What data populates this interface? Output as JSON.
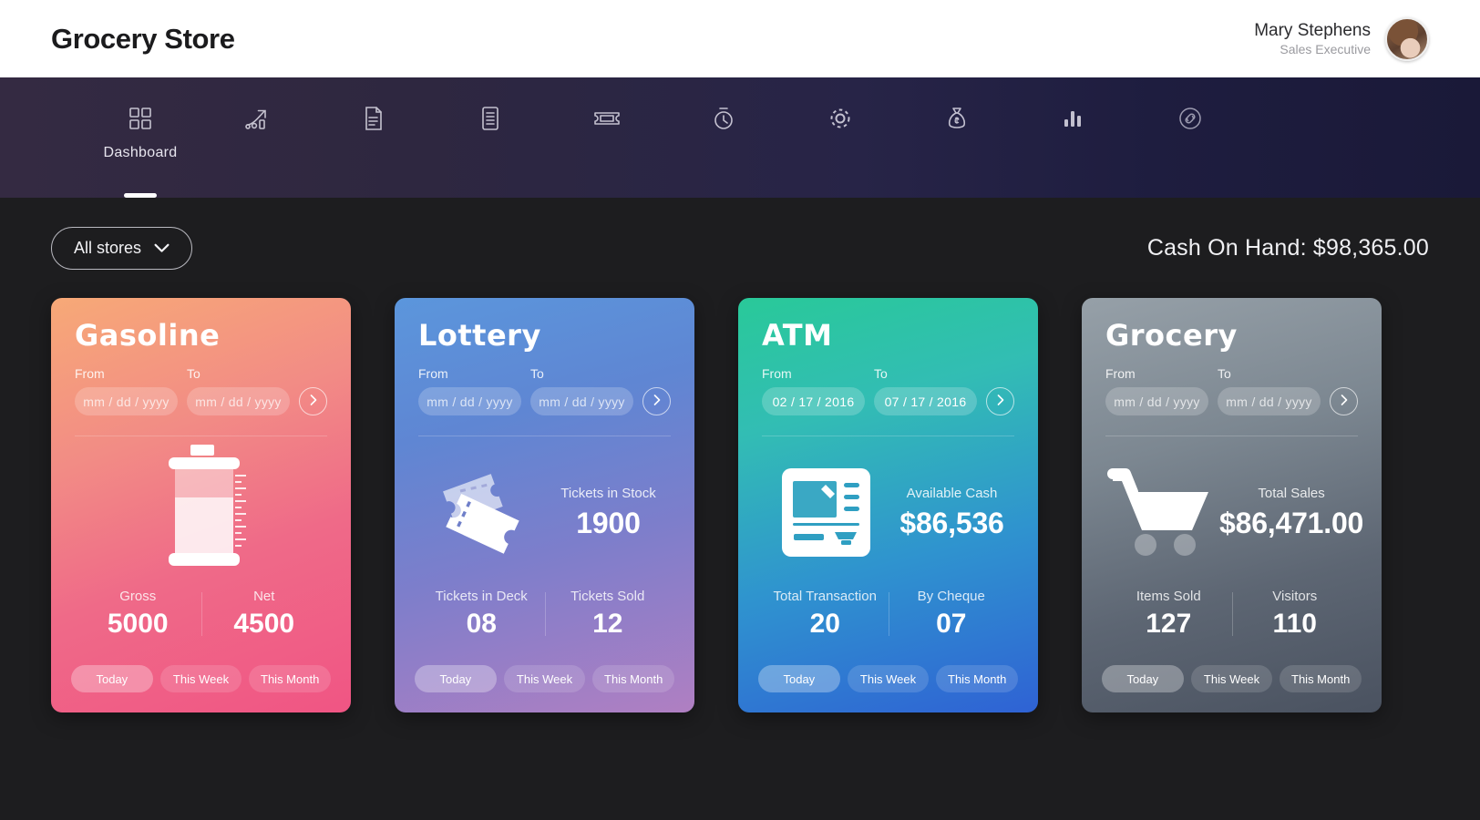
{
  "header": {
    "brand": "Grocery Store",
    "user": {
      "name": "Mary Stephens",
      "role": "Sales Executive",
      "avatar_icon": "user-avatar-photo"
    }
  },
  "nav": {
    "active_index": 0,
    "items": [
      {
        "label": "Dashboard",
        "icon": "grid-dashboard-icon"
      },
      {
        "label": "",
        "icon": "growth-chart-arrow-icon"
      },
      {
        "label": "",
        "icon": "document-report-icon"
      },
      {
        "label": "",
        "icon": "list-lines-icon"
      },
      {
        "label": "",
        "icon": "ticket-icon"
      },
      {
        "label": "",
        "icon": "stopwatch-icon"
      },
      {
        "label": "",
        "icon": "gear-settings-icon"
      },
      {
        "label": "",
        "icon": "money-bag-icon"
      },
      {
        "label": "",
        "icon": "bar-chart-icon"
      },
      {
        "label": "",
        "icon": "link-chain-icon"
      }
    ]
  },
  "toolbar": {
    "store_filter": "All stores",
    "store_filter_icon": "chevron-down-icon",
    "cash_on_hand": "Cash On Hand: $98,365.00"
  },
  "cards": [
    {
      "id": "gasoline",
      "title": "Gasoline",
      "visual_icon": "fuel-gauge-tank-icon",
      "from_label": "From",
      "to_label": "To",
      "from_value": "mm / dd / yyyy",
      "to_value": "mm / dd / yyyy",
      "from_is_placeholder": true,
      "to_is_placeholder": true,
      "go_icon": "chevron-right-icon",
      "headline_label": "",
      "headline_value": "",
      "stats": [
        {
          "label": "Gross",
          "value": "5000"
        },
        {
          "label": "Net",
          "value": "4500"
        }
      ],
      "ranges": [
        {
          "label": "Today",
          "active": true
        },
        {
          "label": "This Week",
          "active": false
        },
        {
          "label": "This Month",
          "active": false
        }
      ]
    },
    {
      "id": "lottery",
      "title": "Lottery",
      "visual_icon": "lottery-tickets-icon",
      "from_label": "From",
      "to_label": "To",
      "from_value": "mm / dd / yyyy",
      "to_value": "mm / dd / yyyy",
      "from_is_placeholder": true,
      "to_is_placeholder": true,
      "go_icon": "chevron-right-icon",
      "headline_label": "Tickets in Stock",
      "headline_value": "1900",
      "stats": [
        {
          "label": "Tickets in Deck",
          "value": "08"
        },
        {
          "label": "Tickets Sold",
          "value": "12"
        }
      ],
      "ranges": [
        {
          "label": "Today",
          "active": true
        },
        {
          "label": "This Week",
          "active": false
        },
        {
          "label": "This Month",
          "active": false
        }
      ]
    },
    {
      "id": "atm",
      "title": "ATM",
      "visual_icon": "atm-machine-icon",
      "from_label": "From",
      "to_label": "To",
      "from_value": "02 / 17 / 2016",
      "to_value": "07 / 17 / 2016",
      "from_is_placeholder": false,
      "to_is_placeholder": false,
      "go_icon": "chevron-right-icon",
      "headline_label": "Available Cash",
      "headline_value": "$86,536",
      "stats": [
        {
          "label": "Total Transaction",
          "value": "20"
        },
        {
          "label": "By Cheque",
          "value": "07"
        }
      ],
      "ranges": [
        {
          "label": "Today",
          "active": true
        },
        {
          "label": "This Week",
          "active": false
        },
        {
          "label": "This Month",
          "active": false
        }
      ]
    },
    {
      "id": "grocery",
      "title": "Grocery",
      "visual_icon": "shopping-cart-icon",
      "from_label": "From",
      "to_label": "To",
      "from_value": "mm / dd / yyyy",
      "to_value": "mm / dd / yyyy",
      "from_is_placeholder": true,
      "to_is_placeholder": true,
      "go_icon": "chevron-right-icon",
      "headline_label": "Total Sales",
      "headline_value": "$86,471.00",
      "stats": [
        {
          "label": "Items Sold",
          "value": "127"
        },
        {
          "label": "Visitors",
          "value": "110"
        }
      ],
      "ranges": [
        {
          "label": "Today",
          "active": true
        },
        {
          "label": "This Week",
          "active": false
        },
        {
          "label": "This Month",
          "active": false
        }
      ]
    }
  ],
  "colors": {
    "page_bg": "#1d1d1f",
    "topbar_bg": "#ffffff",
    "nav_start": "#342a42",
    "nav_end": "#1a1938",
    "gasoline_accent": "#f05584",
    "lottery_accent": "#7d7ecb",
    "atm_accent": "#29c999",
    "grocery_accent": "#5d6673"
  }
}
